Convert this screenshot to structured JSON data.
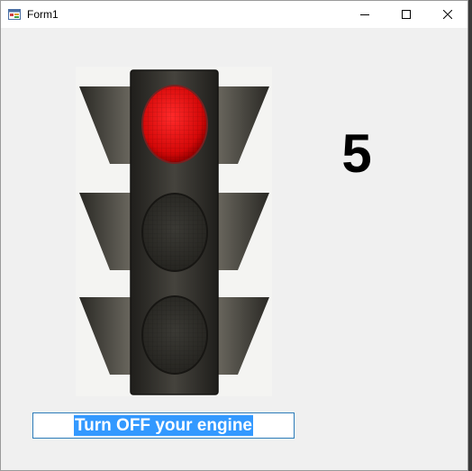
{
  "window": {
    "title": "Form1",
    "icon": "winforms-app-icon",
    "controls": {
      "minimize": "minimize-icon",
      "maximize": "maximize-icon",
      "close": "close-icon"
    }
  },
  "traffic_light": {
    "active_lamp": "red",
    "lamps": [
      "red",
      "yellow",
      "green"
    ],
    "colors": {
      "red_on": "#e01010",
      "lamp_off": "#2e2d29",
      "housing": "#3a3833"
    }
  },
  "countdown": {
    "value": "5"
  },
  "message": {
    "text": "Turn OFF your engine",
    "selected": true,
    "selection_color": "#3399ff"
  }
}
